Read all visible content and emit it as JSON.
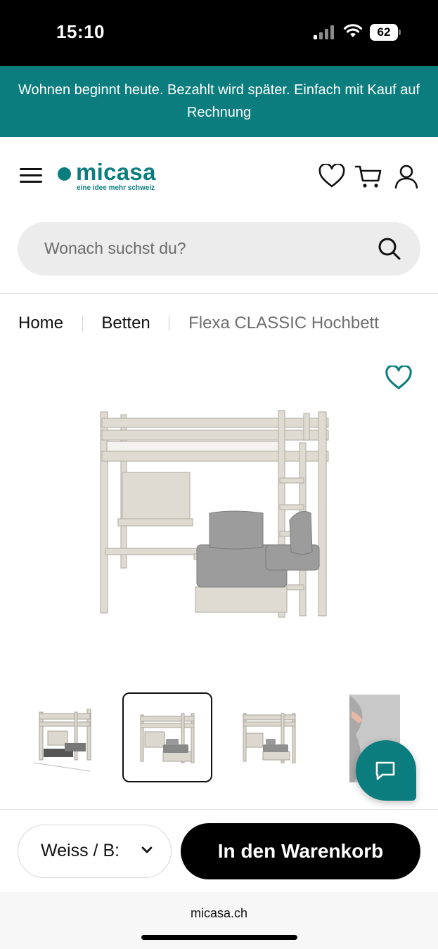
{
  "status_bar": {
    "time": "15:10",
    "battery": "62"
  },
  "promo": {
    "text": "Wohnen beginnt heute. Bezahlt wird später. Einfach mit Kauf auf Rechnung"
  },
  "header": {
    "logo_text": "micasa",
    "logo_tagline": "eine idee mehr schweiz",
    "brand_color": "#0b7d7e",
    "icons": [
      "menu-icon",
      "heart-icon",
      "cart-icon",
      "user-icon"
    ]
  },
  "search": {
    "placeholder": "Wonach suchst du?"
  },
  "breadcrumb": {
    "items": [
      "Home",
      "Betten",
      "Flexa CLASSIC Hochbett"
    ]
  },
  "product": {
    "thumbnail_count": 4,
    "active_thumbnail": 2
  },
  "bottom_bar": {
    "variant_value": "Weiss / B:",
    "add_to_cart_label": "In den Warenkorb"
  },
  "browser": {
    "url": "micasa.ch"
  }
}
